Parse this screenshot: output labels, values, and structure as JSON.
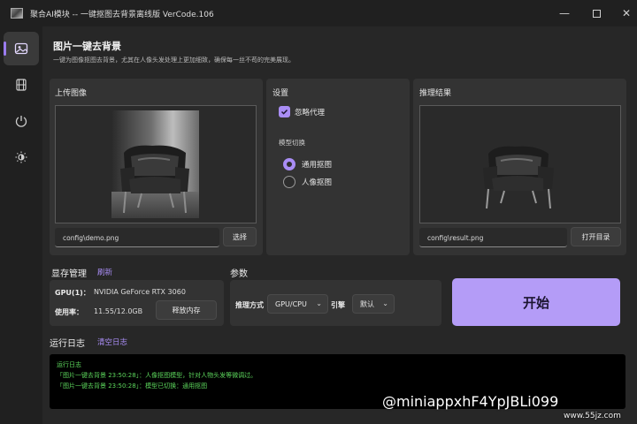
{
  "window": {
    "title": "聚合AI模块 -- 一键抠图去背景离线版 VerCode.106",
    "min_glyph": "—",
    "close_glyph": "✕"
  },
  "sidebar": {
    "items": [
      {
        "icon": "image-icon",
        "active": true
      },
      {
        "icon": "film-icon",
        "active": false
      },
      {
        "icon": "power-icon",
        "active": false
      },
      {
        "icon": "brightness-icon",
        "active": false
      }
    ]
  },
  "page": {
    "title": "图片一键去背景",
    "subtitle": "一键为图像抠图去背景，尤其在人像头发处理上更加细致，确保每一丝不苟的完美展现。"
  },
  "upload": {
    "title": "上传图像",
    "path": "config\\demo.png",
    "choose_label": "选择"
  },
  "settings": {
    "title": "设置",
    "ignore_proxy_label": "忽略代理",
    "ignore_proxy_checked": true,
    "model_switch_label": "模型切换",
    "model_options": [
      "通用抠图",
      "人像抠图"
    ],
    "model_selected": "通用抠图"
  },
  "result": {
    "title": "推理结果",
    "path": "config\\result.png",
    "open_dir_label": "打开目录"
  },
  "vram": {
    "title": "显存管理",
    "refresh_label": "刷新",
    "gpu_key": "GPU(1)：",
    "gpu_value": "NVIDIA GeForce RTX 3060",
    "usage_key": "使用率：",
    "usage_value": "11.55/12.0GB",
    "release_label": "释放内存"
  },
  "params": {
    "title": "参数",
    "method_label": "推理方式",
    "method_value": "GPU/CPU",
    "engine_label": "引擎",
    "engine_value": "默认",
    "chevron": "⌄"
  },
  "start_label": "开始",
  "logs": {
    "title": "运行日志",
    "clear_label": "清空日志",
    "lines": [
      "运行日志",
      "「图片一键去背景 23:50:28」：人像抠图模型，针对人物头发等微调过。",
      "「图片一键去背景 23:50:28」：模型已切换：通用抠图"
    ]
  },
  "watermark": {
    "text": "@miniappxhF4YpJBLi099",
    "site": "www.55jz.com"
  },
  "colors": {
    "accent": "#a98df5",
    "start_button": "#b49cf7",
    "log_text": "#5cd65c",
    "background": "#272727"
  }
}
